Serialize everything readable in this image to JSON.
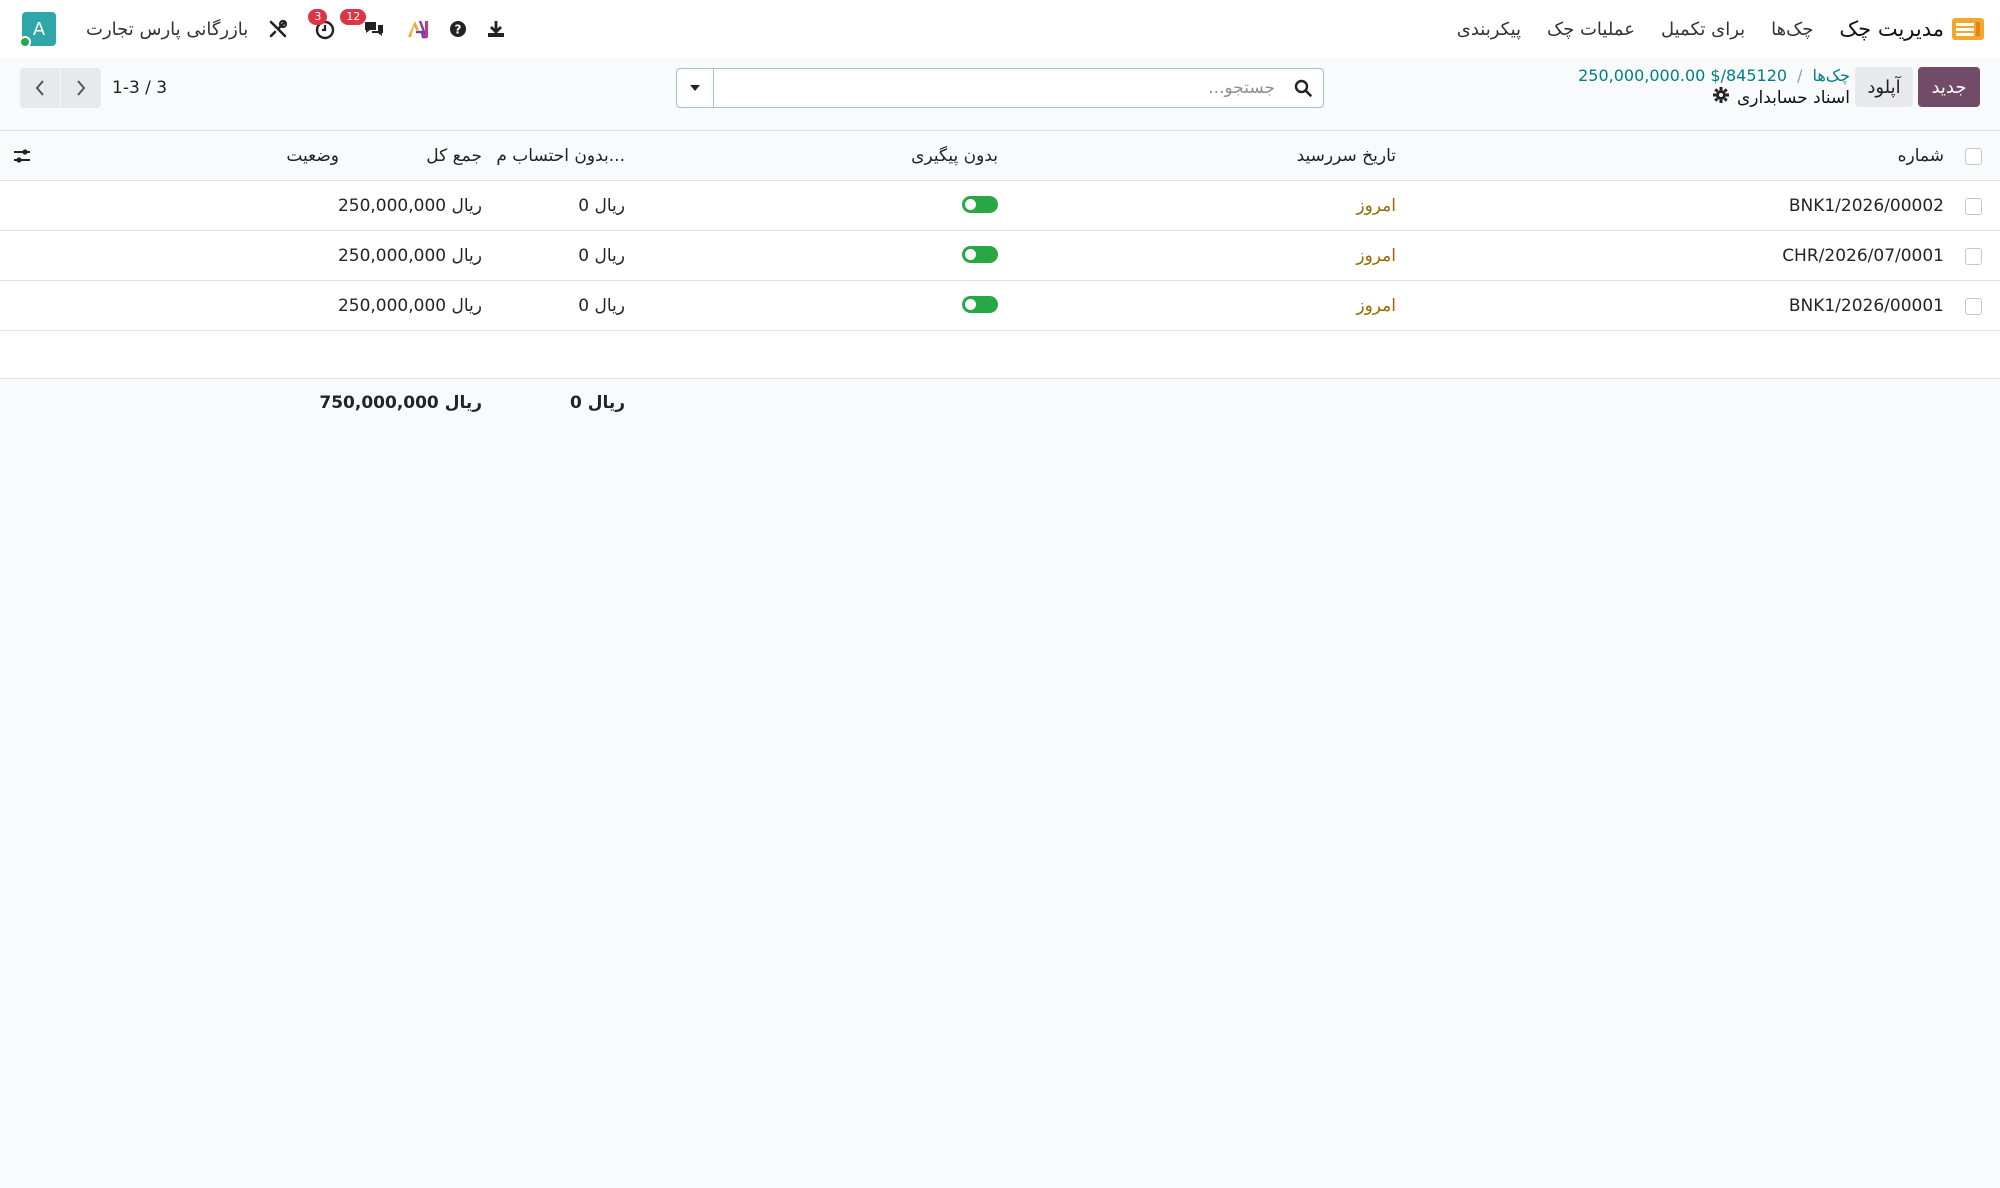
{
  "navbar": {
    "app_title": "مدیریت چک",
    "menu": [
      "چک‌ها",
      "برای تکمیل",
      "عملیات چک",
      "پیکربندی"
    ],
    "company": "بازرگانی پارس تجارت",
    "avatar_letter": "A",
    "chat_badge": "12",
    "activity_badge": "3"
  },
  "control": {
    "new_label": "جدید",
    "upload_label": "آپلود",
    "breadcrumb_parent": "چک‌ها",
    "breadcrumb_separator": "/",
    "breadcrumb_current": "250,000,000.00 $/845120",
    "page_subtitle": "اسناد حسابداری",
    "search_placeholder": "جستجو...",
    "pager": "1-3 / 3"
  },
  "table": {
    "headers": {
      "number": "شماره",
      "due_date": "تاریخ سررسید",
      "no_followup": "بدون پیگیری",
      "no_calc": "بدون احتساب م...",
      "total": "جمع کل",
      "status": "وضعیت"
    },
    "rows": [
      {
        "number": "BNK1/2026/00002",
        "due_date": "امروز",
        "no_followup": true,
        "no_calc": "0 ریال",
        "total": "250,000,000 ریال",
        "status": ""
      },
      {
        "number": "CHR/2026/07/0001",
        "due_date": "امروز",
        "no_followup": true,
        "no_calc": "0 ریال",
        "total": "250,000,000 ریال",
        "status": ""
      },
      {
        "number": "BNK1/2026/00001",
        "due_date": "امروز",
        "no_followup": true,
        "no_calc": "0 ریال",
        "total": "250,000,000 ریال",
        "status": ""
      }
    ],
    "footer": {
      "no_calc": "0 ریال",
      "total": "750,000,000 ریال"
    }
  },
  "colors": {
    "primary": "#714b67",
    "teal": "#017e84",
    "toggle_on": "#28a745",
    "date_text": "#9a6a00",
    "badge": "#dc3545"
  }
}
